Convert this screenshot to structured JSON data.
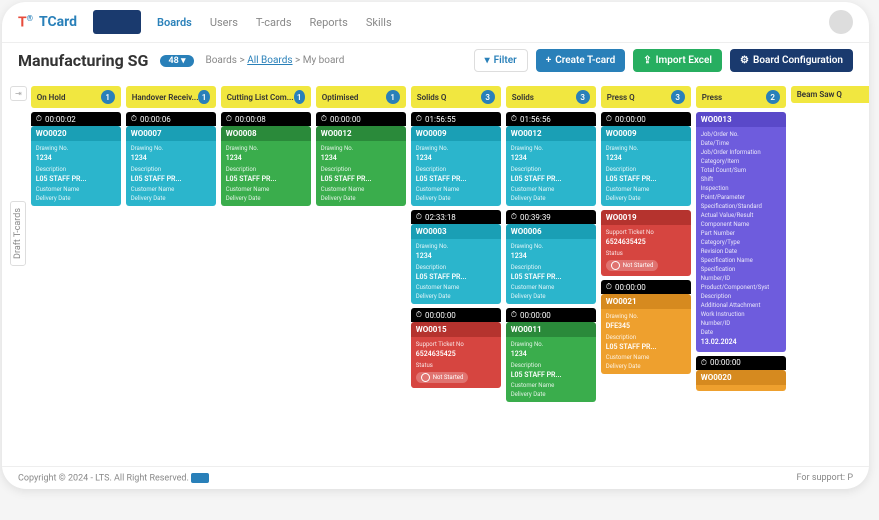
{
  "brand": {
    "t": "T",
    "name": "TCard"
  },
  "nav": {
    "boards": "Boards",
    "users": "Users",
    "tcards": "T-cards",
    "reports": "Reports",
    "skills": "Skills"
  },
  "page": {
    "title": "Manufacturing SG",
    "count": "48"
  },
  "crumb": {
    "root": "Boards",
    "all": "All Boards",
    "current": "My board",
    "sep": ">"
  },
  "actions": {
    "filter": "Filter",
    "create": "Create T-card",
    "import": "Import Excel",
    "config": "Board Configuration"
  },
  "draft": "Draft T-cards",
  "columns": [
    {
      "title": "On Hold",
      "count": "1",
      "cards": [
        {
          "color": "teal",
          "timer": "00:00:02",
          "id": "WO0020",
          "fields": [
            [
              "Drawing No.",
              "1234"
            ],
            [
              "Description",
              "L05 STAFF PR..."
            ],
            [
              "Customer Name",
              ""
            ],
            [
              "Delivery Date",
              ""
            ]
          ]
        }
      ]
    },
    {
      "title": "Handover Receiv...",
      "count": "1",
      "cards": [
        {
          "color": "teal",
          "timer": "00:00:06",
          "id": "WO0007",
          "fields": [
            [
              "Drawing No.",
              "1234"
            ],
            [
              "Description",
              "L05 STAFF PR..."
            ],
            [
              "Customer Name",
              ""
            ],
            [
              "Delivery Date",
              ""
            ]
          ]
        }
      ]
    },
    {
      "title": "Cutting List Com...",
      "count": "1",
      "cards": [
        {
          "color": "green",
          "timer": "00:00:08",
          "id": "WO0008",
          "fields": [
            [
              "Drawing No.",
              "1234"
            ],
            [
              "Description",
              "L05 STAFF PR..."
            ],
            [
              "Customer Name",
              ""
            ],
            [
              "Delivery Date",
              ""
            ]
          ]
        }
      ]
    },
    {
      "title": "Optimised",
      "count": "1",
      "cards": [
        {
          "color": "green",
          "timer": "00:00:00",
          "id": "WO0012",
          "fields": [
            [
              "Drawing No.",
              "1234"
            ],
            [
              "Description",
              "L05 STAFF PR..."
            ],
            [
              "Customer Name",
              ""
            ],
            [
              "Delivery Date",
              ""
            ]
          ]
        }
      ]
    },
    {
      "title": "Solids Q",
      "count": "3",
      "cards": [
        {
          "color": "teal",
          "timer": "01:56:55",
          "id": "WO0009",
          "fields": [
            [
              "Drawing No.",
              "1234"
            ],
            [
              "Description",
              "L05 STAFF PR..."
            ],
            [
              "Customer Name",
              ""
            ],
            [
              "Delivery Date",
              ""
            ]
          ]
        },
        {
          "color": "teal",
          "timer": "02:33:18",
          "id": "WO0003",
          "fields": [
            [
              "Drawing No.",
              "1234"
            ],
            [
              "Description",
              "L05 STAFF PR..."
            ],
            [
              "Customer Name",
              ""
            ],
            [
              "Delivery Date",
              ""
            ]
          ]
        },
        {
          "color": "red",
          "timer": "00:00:00",
          "id": "WO0015",
          "fields": [
            [
              "Support Ticket No",
              "6524635425"
            ],
            [
              "Status",
              ""
            ]
          ],
          "status": "Not Started"
        }
      ]
    },
    {
      "title": "Solids",
      "count": "3",
      "cards": [
        {
          "color": "teal",
          "timer": "01:56:56",
          "id": "WO0012",
          "fields": [
            [
              "Drawing No.",
              "1234"
            ],
            [
              "Description",
              "L05 STAFF PR..."
            ],
            [
              "Customer Name",
              ""
            ],
            [
              "Delivery Date",
              ""
            ]
          ]
        },
        {
          "color": "teal",
          "timer": "00:39:39",
          "id": "WO0006",
          "fields": [
            [
              "Drawing No.",
              "1234"
            ],
            [
              "Description",
              "L05 STAFF PR..."
            ],
            [
              "Customer Name",
              ""
            ],
            [
              "Delivery Date",
              ""
            ]
          ]
        },
        {
          "color": "green",
          "timer": "00:00:00",
          "id": "WO0011",
          "fields": [
            [
              "Drawing No.",
              "1234"
            ],
            [
              "Description",
              "L05 STAFF PR..."
            ],
            [
              "Customer Name",
              ""
            ],
            [
              "Delivery Date",
              ""
            ]
          ]
        }
      ]
    },
    {
      "title": "Press Q",
      "count": "3",
      "cards": [
        {
          "color": "teal",
          "timer": "00:00:00",
          "id": "WO0009",
          "fields": [
            [
              "Drawing No.",
              "1234"
            ],
            [
              "Description",
              "L05 STAFF PR..."
            ],
            [
              "Customer Name",
              ""
            ],
            [
              "Delivery Date",
              ""
            ]
          ]
        },
        {
          "color": "red",
          "timer": "",
          "id": "WO0019",
          "fields": [
            [
              "Support Ticket No",
              "6524635425"
            ],
            [
              "Status",
              ""
            ]
          ],
          "status": "Not Started"
        },
        {
          "color": "orange",
          "timer": "00:00:00",
          "id": "WO0021",
          "fields": [
            [
              "Drawing No.",
              "DFE345"
            ],
            [
              "Description",
              "L05 STAFF PR..."
            ],
            [
              "Customer Name",
              ""
            ],
            [
              "Delivery Date",
              ""
            ]
          ]
        }
      ]
    },
    {
      "title": "Press",
      "count": "2",
      "cards": [
        {
          "color": "purple",
          "timer": "",
          "id": "WO0013",
          "fields": [
            [
              "Job/Order No.",
              ""
            ],
            [
              "Date/Time",
              ""
            ],
            [
              "Job/Order Information",
              ""
            ],
            [
              "Category/Item",
              ""
            ],
            [
              "Total Count/Sum",
              ""
            ],
            [
              "Shift",
              ""
            ],
            [
              "Inspection",
              ""
            ],
            [
              "Point/Parameter",
              ""
            ],
            [
              "Specification/Standard",
              ""
            ],
            [
              "Actual Value/Result",
              ""
            ],
            [
              "Component Name",
              ""
            ],
            [
              "Part Number",
              ""
            ],
            [
              "Category/Type",
              ""
            ],
            [
              "Revision Date",
              ""
            ],
            [
              "Specification Name",
              ""
            ],
            [
              "Specification",
              ""
            ],
            [
              "Number/ID",
              ""
            ],
            [
              "Product/Component/Syst",
              ""
            ],
            [
              "Description",
              ""
            ],
            [
              "Additional Attachment",
              ""
            ],
            [
              "Work Instruction",
              ""
            ],
            [
              "Number/ID",
              ""
            ],
            [
              "Date",
              "13.02.2024"
            ]
          ]
        },
        {
          "color": "orange",
          "timer": "00:00:00",
          "id": "WO0020",
          "fields": []
        }
      ]
    },
    {
      "title": "Beam Saw Q",
      "count": "",
      "cards": []
    }
  ],
  "footer": {
    "copyright": "Copyright © 2024 - LTS. All Right Reserved.",
    "support": "For support: P"
  }
}
